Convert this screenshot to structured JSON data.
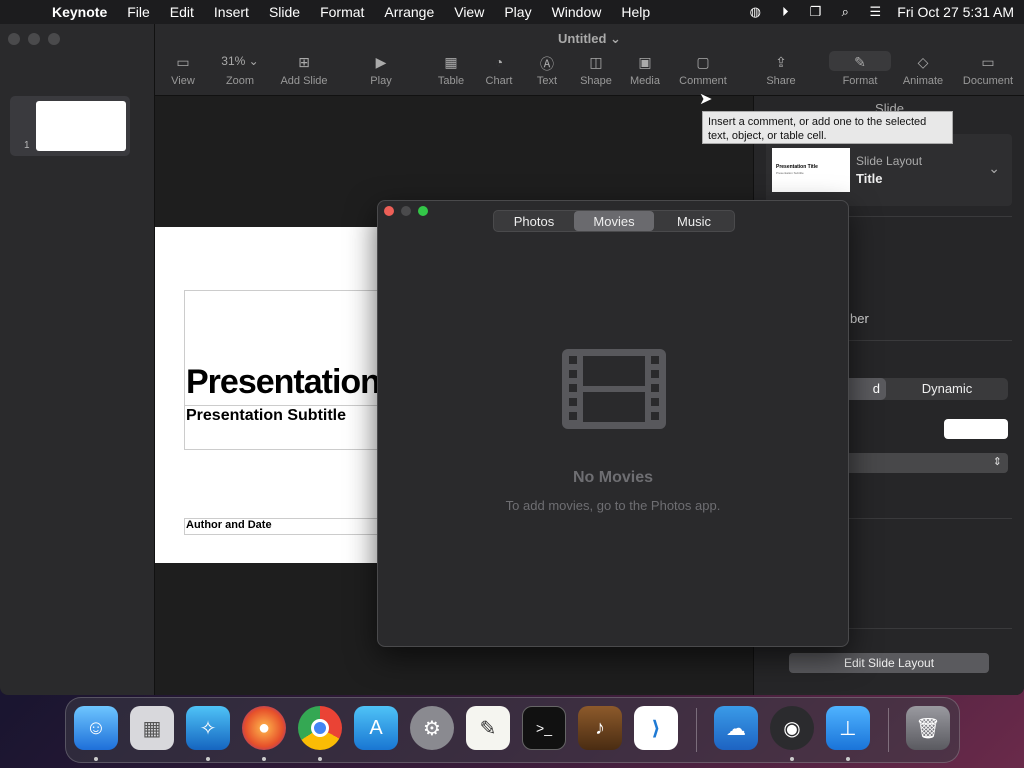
{
  "menubar": {
    "app": "Keynote",
    "items": [
      "File",
      "Edit",
      "Insert",
      "Slide",
      "Format",
      "Arrange",
      "View",
      "Play",
      "Window",
      "Help"
    ],
    "clock": "Fri Oct 27  5:31 AM"
  },
  "window": {
    "title": "Untitled",
    "toolbar": {
      "view": "View",
      "zoom_value": "31%",
      "zoom": "Zoom",
      "add_slide": "Add Slide",
      "play": "Play",
      "table": "Table",
      "chart": "Chart",
      "text": "Text",
      "shape": "Shape",
      "media": "Media",
      "comment": "Comment",
      "share": "Share",
      "format": "Format",
      "animate": "Animate",
      "document": "Document"
    }
  },
  "navigator": {
    "slide_number": "1"
  },
  "slide": {
    "title": "Presentation Title",
    "subtitle": "Presentation Subtitle",
    "author": "Author and Date"
  },
  "tooltip": "Insert a comment, or add one to the selected text, object, or table cell.",
  "inspector": {
    "header": "Slide",
    "layout_label": "Slide Layout",
    "layout_value": "Title",
    "thumb_title": "Presentation Title",
    "thumb_sub": "Presentation Subtitle",
    "partial_label": "ber",
    "seg_left": "d",
    "seg_right": "Dynamic",
    "edit_layout": "Edit Slide Layout"
  },
  "media_browser": {
    "tabs": [
      "Photos",
      "Movies",
      "Music"
    ],
    "active_tab": "Movies",
    "empty_title": "No Movies",
    "empty_sub": "To add movies, go to the Photos app."
  }
}
